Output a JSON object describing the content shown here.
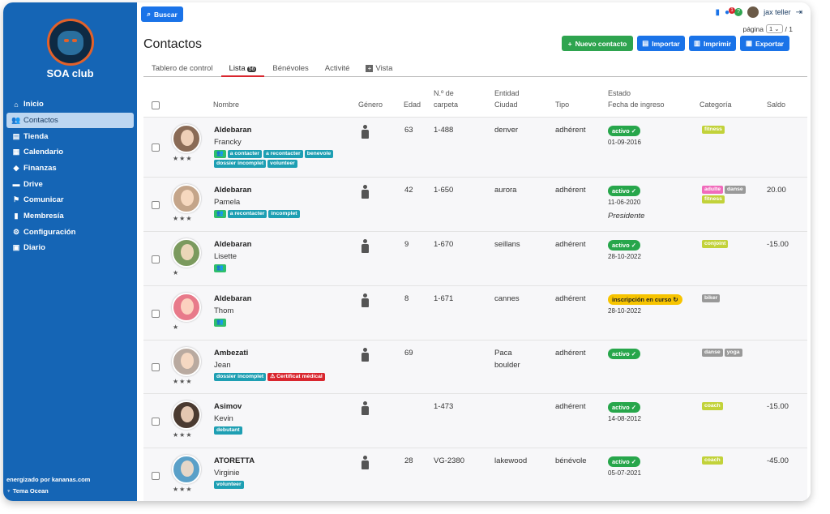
{
  "app": {
    "club_name": "SOA club",
    "powered_by": "energizado por kananas.com",
    "theme": "Tema Ocean"
  },
  "sidebar": {
    "items": [
      {
        "label": "Inicio",
        "icon": "home-icon",
        "glyph": "⌂"
      },
      {
        "label": "Contactos",
        "icon": "users-icon",
        "glyph": "👥"
      },
      {
        "label": "Tienda",
        "icon": "store-icon",
        "glyph": "▤"
      },
      {
        "label": "Calendario",
        "icon": "calendar-icon",
        "glyph": "▦"
      },
      {
        "label": "Finanzas",
        "icon": "piggy-bank-icon",
        "glyph": "◆"
      },
      {
        "label": "Drive",
        "icon": "drive-icon",
        "glyph": "▬"
      },
      {
        "label": "Comunicar",
        "icon": "broadcast-icon",
        "glyph": "⚑"
      },
      {
        "label": "Membresía",
        "icon": "membership-icon",
        "glyph": "▮"
      },
      {
        "label": "Configuración",
        "icon": "gear-icon",
        "glyph": "⚙"
      },
      {
        "label": "Diario",
        "icon": "journal-icon",
        "glyph": "▣"
      }
    ]
  },
  "header": {
    "search_label": "Buscar",
    "user_name": "jax teller",
    "notifications": "1",
    "pagination_label": "página",
    "page_value": "1",
    "page_total": "/ 1",
    "page_title": "Contactos",
    "buttons": {
      "new_contact": "Nuevo contacto",
      "import": "Importar",
      "print": "Imprimir",
      "export": "Exportar"
    }
  },
  "tabs": [
    {
      "label": "Tablero de control"
    },
    {
      "label": "Lista",
      "count": "56"
    },
    {
      "label": "Bénévoles"
    },
    {
      "label": "Activité"
    },
    {
      "label": "Vista"
    }
  ],
  "columns": {
    "name": "Nombre",
    "gender": "Género",
    "age": "Edad",
    "folder_1": "N.º de",
    "folder_2": "carpeta",
    "entity_1": "Entidad",
    "entity_2": "Ciudad",
    "type": "Tipo",
    "status_1": "Estado",
    "status_2": "Fecha de ingreso",
    "category": "Categoría",
    "balance": "Saldo"
  },
  "rows": [
    {
      "last": "Aldebaran",
      "first": "Francky",
      "stars": "★★★",
      "age": "63",
      "folder": "1-488",
      "entity": "denver",
      "entity2": "",
      "type": "adhérent",
      "status": "activo ✓",
      "status_kind": "green",
      "date": "01-09-2016",
      "role": "",
      "balance": "",
      "tags": [
        {
          "t": "👥",
          "c": "grp"
        },
        {
          "t": "a contacter",
          "c": "teal"
        },
        {
          "t": "a recontacter",
          "c": "teal"
        },
        {
          "t": "benevole",
          "c": "teal"
        },
        {
          "t": "dossier incomplet",
          "c": "teal"
        },
        {
          "t": "volunteer",
          "c": "teal"
        }
      ],
      "cats": [
        {
          "t": "fitness",
          "c": "lime"
        }
      ]
    },
    {
      "last": "Aldebaran",
      "first": "Pamela",
      "stars": "★★★",
      "age": "42",
      "folder": "1-650",
      "entity": "aurora",
      "entity2": "",
      "type": "adhérent",
      "status": "activo ✓",
      "status_kind": "green",
      "date": "11-06-2020",
      "role": "Presidente",
      "balance": "20.00",
      "tags": [
        {
          "t": "👥",
          "c": "grp"
        },
        {
          "t": "a recontacter",
          "c": "teal"
        },
        {
          "t": "incomplet",
          "c": "teal"
        }
      ],
      "cats": [
        {
          "t": "adulte",
          "c": "pink"
        },
        {
          "t": "danse",
          "c": "gray"
        },
        {
          "t": "fitness",
          "c": "lime"
        }
      ]
    },
    {
      "last": "Aldebaran",
      "first": "Lisette",
      "stars": "★",
      "age": "9",
      "folder": "1-670",
      "entity": "seillans",
      "entity2": "",
      "type": "adhérent",
      "status": "activo ✓",
      "status_kind": "green",
      "date": "28-10-2022",
      "role": "",
      "balance": "-15.00",
      "tags": [
        {
          "t": "👥",
          "c": "grp"
        }
      ],
      "cats": [
        {
          "t": "conjoint",
          "c": "lime"
        }
      ]
    },
    {
      "last": "Aldebaran",
      "first": "Thom",
      "stars": "★",
      "age": "8",
      "folder": "1-671",
      "entity": "cannes",
      "entity2": "",
      "type": "adhérent",
      "status": "inscripción en curso ↻",
      "status_kind": "yellow",
      "date": "28-10-2022",
      "role": "",
      "balance": "",
      "tags": [
        {
          "t": "👥",
          "c": "grp"
        }
      ],
      "cats": [
        {
          "t": "biker",
          "c": "gray"
        }
      ]
    },
    {
      "last": "Ambezati",
      "first": "Jean",
      "stars": "★★★",
      "age": "69",
      "folder": "",
      "entity": "Paca",
      "entity2": "boulder",
      "type": "adhérent",
      "status": "activo ✓",
      "status_kind": "green",
      "date": "",
      "role": "",
      "balance": "",
      "tags": [
        {
          "t": "dossier incomplet",
          "c": "teal"
        },
        {
          "t": "⚠ Certificat médical",
          "c": "red"
        }
      ],
      "cats": [
        {
          "t": "danse",
          "c": "gray"
        },
        {
          "t": "yoga",
          "c": "gray"
        }
      ]
    },
    {
      "last": "Asimov",
      "first": "Kevin",
      "stars": "★★★",
      "age": "",
      "folder": "1-473",
      "entity": "",
      "entity2": "",
      "type": "adhérent",
      "status": "activo ✓",
      "status_kind": "green",
      "date": "14-08-2012",
      "role": "",
      "balance": "-15.00",
      "tags": [
        {
          "t": "debutant",
          "c": "teal"
        }
      ],
      "cats": [
        {
          "t": "coach",
          "c": "lime"
        }
      ]
    },
    {
      "last": "ATORETTA",
      "first": "Virginie",
      "stars": "★★★",
      "age": "28",
      "folder": "VG-2380",
      "entity": "lakewood",
      "entity2": "",
      "type": "bénévole",
      "status": "activo ✓",
      "status_kind": "green",
      "date": "05-07-2021",
      "role": "",
      "balance": "-45.00",
      "tags": [
        {
          "t": "volunteer",
          "c": "teal"
        }
      ],
      "cats": [
        {
          "t": "coach",
          "c": "lime"
        }
      ]
    }
  ],
  "colors": {
    "sidebar": "#1565b5",
    "accent": "#1a73e8",
    "success": "#2ea44f",
    "danger": "#d9262e",
    "warning": "#f7c400"
  }
}
